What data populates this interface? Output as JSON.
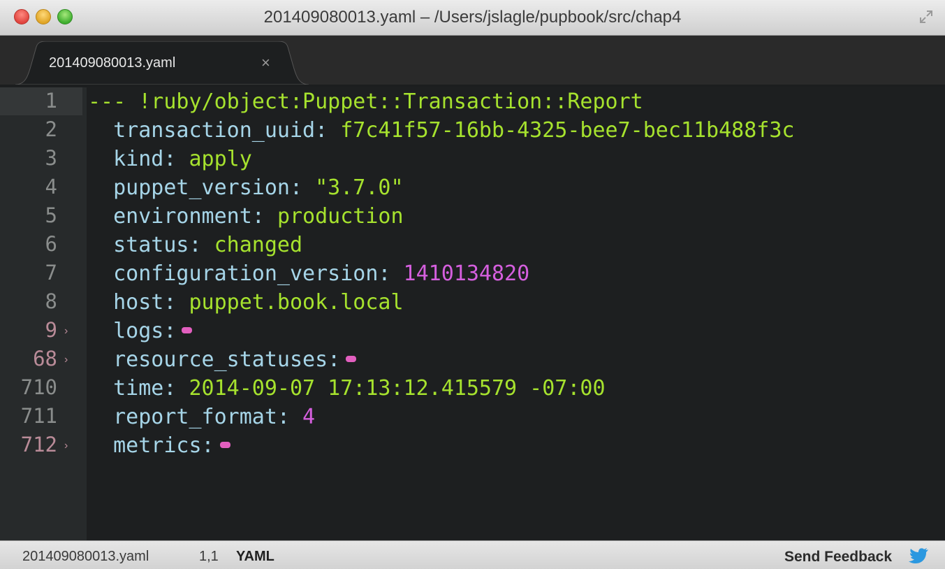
{
  "window": {
    "title": "201409080013.yaml – /Users/jslagle/pupbook/src/chap4"
  },
  "tab": {
    "label": "201409080013.yaml",
    "close": "×"
  },
  "gutter": [
    {
      "num": "1",
      "fold": ""
    },
    {
      "num": "2",
      "fold": ""
    },
    {
      "num": "3",
      "fold": ""
    },
    {
      "num": "4",
      "fold": ""
    },
    {
      "num": "5",
      "fold": ""
    },
    {
      "num": "6",
      "fold": ""
    },
    {
      "num": "7",
      "fold": ""
    },
    {
      "num": "8",
      "fold": ""
    },
    {
      "num": "9",
      "fold": "›"
    },
    {
      "num": "68",
      "fold": "›"
    },
    {
      "num": "710",
      "fold": ""
    },
    {
      "num": "711",
      "fold": ""
    },
    {
      "num": "712",
      "fold": "›"
    }
  ],
  "code": {
    "l1": "--- !ruby/object:Puppet::Transaction::Report",
    "l2_key": "  transaction_uuid:",
    "l2_val": "f7c41f57-16bb-4325-bee7-bec11b488f3c",
    "l3_key": "  kind:",
    "l3_val": "apply",
    "l4_key": "  puppet_version:",
    "l4_val": "\"3.7.0\"",
    "l5_key": "  environment:",
    "l5_val": "production",
    "l6_key": "  status:",
    "l6_val": "changed",
    "l7_key": "  configuration_version:",
    "l7_val": "1410134820",
    "l8_key": "  host:",
    "l8_val": "puppet.book.local",
    "l9_key": "  logs:",
    "l10_key": "  resource_statuses:",
    "l11_key": "  time:",
    "l11_val": "2014-09-07 17:13:12.415579 -07:00",
    "l12_key": "  report_format:",
    "l12_val": "4",
    "l13_key": "  metrics:"
  },
  "status": {
    "file": "201409080013.yaml",
    "position": "1,1",
    "syntax": "YAML",
    "feedback": "Send Feedback"
  },
  "colors": {
    "key": "#a6d5e8",
    "string": "#a6e22e",
    "number": "#d55fde",
    "background": "#1d1f20"
  }
}
